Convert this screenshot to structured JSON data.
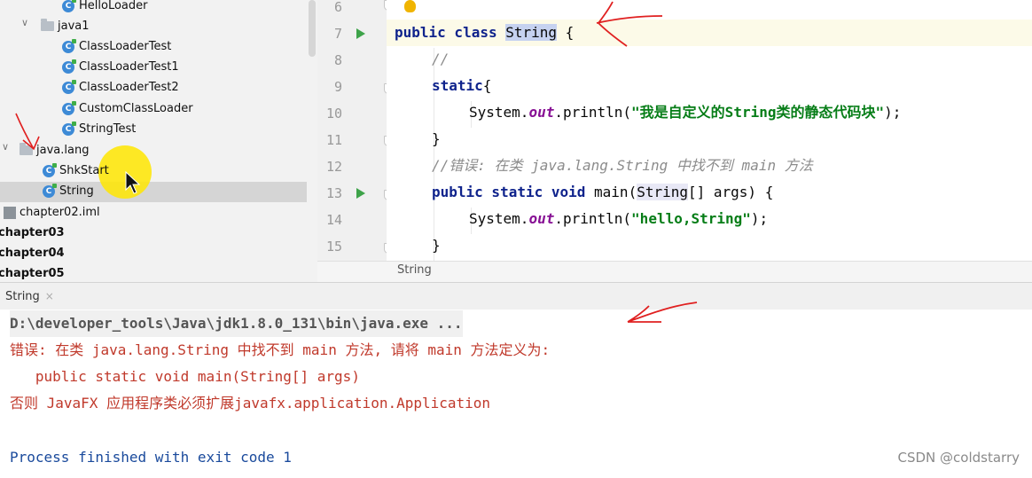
{
  "project_tree": {
    "items": [
      {
        "label": "HelloLoader",
        "kind": "class"
      },
      {
        "label": "java1",
        "kind": "package",
        "expanded": true
      },
      {
        "label": "ClassLoaderTest",
        "kind": "class"
      },
      {
        "label": "ClassLoaderTest1",
        "kind": "class"
      },
      {
        "label": "ClassLoaderTest2",
        "kind": "class"
      },
      {
        "label": "CustomClassLoader",
        "kind": "class"
      },
      {
        "label": "StringTest",
        "kind": "class"
      },
      {
        "label": "java.lang",
        "kind": "package",
        "expanded": true
      },
      {
        "label": "ShkStart",
        "kind": "class"
      },
      {
        "label": "String",
        "kind": "class",
        "selected": true
      },
      {
        "label": "chapter02.iml",
        "kind": "iml"
      },
      {
        "label": "chapter03",
        "kind": "module"
      },
      {
        "label": "chapter04",
        "kind": "module"
      },
      {
        "label": "chapter05",
        "kind": "module"
      }
    ]
  },
  "editor": {
    "line_numbers": [
      "6",
      "7",
      "8",
      "9",
      "10",
      "11",
      "12",
      "13",
      "14",
      "15"
    ],
    "code": {
      "l7_kw": "public class ",
      "l7_name": "String",
      "l7_rest": " {",
      "l8": "//",
      "l9_kw": "static",
      "l9_rest": "{",
      "l10_pre": "System.",
      "l10_out": "out",
      "l10_mid": ".println(",
      "l10_str": "\"我是自定义的String类的静态代码块\"",
      "l10_end": ");",
      "l11": "}",
      "l12": "//错误: 在类 java.lang.String 中找不到 main 方法",
      "l13_kw": "public static void ",
      "l13_mid": "main(",
      "l13_type": "String",
      "l13_end": "[] args) {",
      "l14_pre": "System.",
      "l14_out": "out",
      "l14_mid": ".println(",
      "l14_str": "\"hello,String\"",
      "l14_end": ");",
      "l15": "}"
    },
    "breadcrumb": "String"
  },
  "run_panel": {
    "tab_label": "String",
    "tab_close": "×",
    "lines": {
      "cmd": "D:\\developer_tools\\Java\\jdk1.8.0_131\\bin\\java.exe ...",
      "err1": "错误: 在类 java.lang.String 中找不到 main 方法, 请将 main 方法定义为:",
      "err2": "   public static void main(String[] args)",
      "err3": "否则 JavaFX 应用程序类必须扩展javafx.application.Application",
      "exit": "Process finished with exit code 1"
    },
    "watermark": "CSDN @coldstarry"
  },
  "colors": {
    "keyword": "#0f238c",
    "string": "#067d17",
    "error_text": "#c0392b",
    "annotation_red": "#e02020"
  }
}
